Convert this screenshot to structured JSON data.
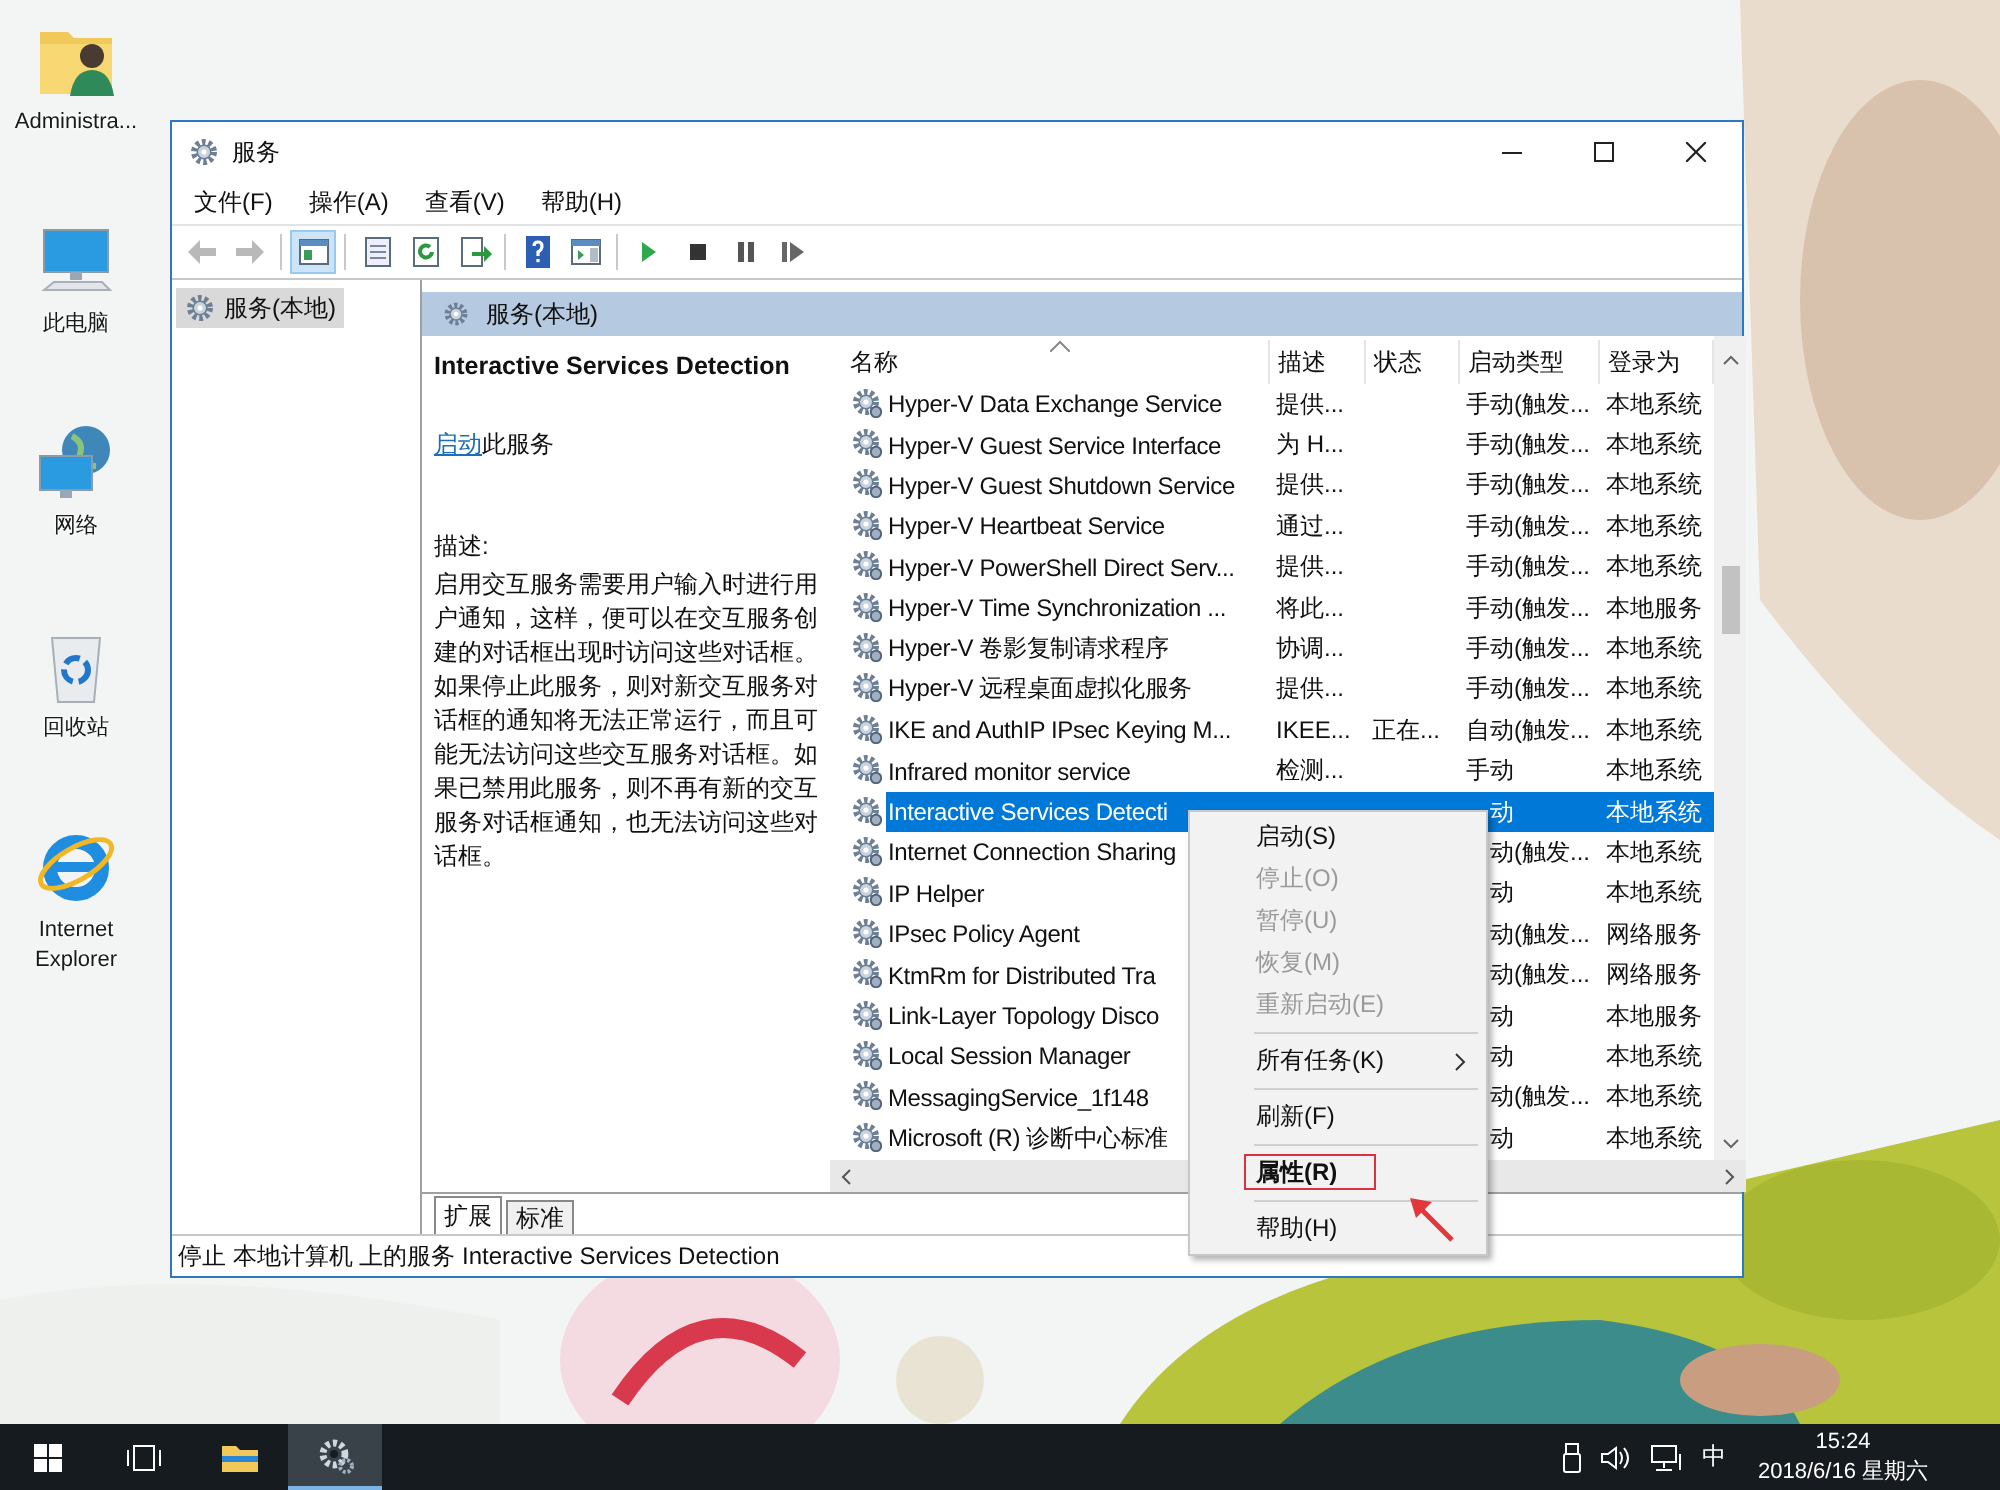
{
  "desktop_icons": [
    {
      "label": "Administra...",
      "kind": "user-folder"
    },
    {
      "label": "此电脑",
      "kind": "computer"
    },
    {
      "label": "网络",
      "kind": "network"
    },
    {
      "label": "回收站",
      "kind": "recycle-bin"
    },
    {
      "label": "Internet Explorer",
      "kind": "browser"
    }
  ],
  "window": {
    "title": "服务"
  },
  "menu": [
    "文件(F)",
    "操作(A)",
    "查看(V)",
    "帮助(H)"
  ],
  "toolbar": [
    {
      "kind": "back",
      "disabled": true,
      "pressed": false
    },
    {
      "kind": "forward",
      "disabled": true,
      "pressed": false
    },
    {
      "kind": "separator"
    },
    {
      "kind": "tree",
      "disabled": false,
      "pressed": true
    },
    {
      "kind": "separator"
    },
    {
      "kind": "properties",
      "disabled": false,
      "pressed": false
    },
    {
      "kind": "refresh",
      "disabled": false,
      "pressed": false
    },
    {
      "kind": "export",
      "disabled": false,
      "pressed": false
    },
    {
      "kind": "separator"
    },
    {
      "kind": "help",
      "disabled": false,
      "pressed": false
    },
    {
      "kind": "action-pane",
      "disabled": false,
      "pressed": false
    },
    {
      "kind": "separator"
    },
    {
      "kind": "play",
      "disabled": false,
      "pressed": false
    },
    {
      "kind": "stop",
      "disabled": false,
      "pressed": false
    },
    {
      "kind": "pause",
      "disabled": false,
      "pressed": false
    },
    {
      "kind": "resume",
      "disabled": false,
      "pressed": false
    }
  ],
  "tree": {
    "items": [
      {
        "label": "服务(本地)",
        "selected": true
      }
    ]
  },
  "pane_header": "服务(本地)",
  "details": {
    "title": "Interactive Services Detection",
    "action_link": "启动",
    "action_text": "此服务",
    "description_label": "描述:",
    "description": "启用交互服务需要用户输入时进行用户通知，这样，便可以在交互服务创建的对话框出现时访问这些对话框。如果停止此服务，则对新交互服务对话框的通知将无法正常运行，而且可能无法访问这些交互服务对话框。如果已禁用此服务，则不再有新的交互服务对话框通知，也无法访问这些对话框。"
  },
  "columns": [
    {
      "label": "名称",
      "sorted": true
    },
    {
      "label": "描述",
      "sorted": false
    },
    {
      "label": "状态",
      "sorted": false
    },
    {
      "label": "启动类型",
      "sorted": false
    },
    {
      "label": "登录为",
      "sorted": false
    }
  ],
  "rows": [
    {
      "name": "Hyper-V Data Exchange Service",
      "description": "提供...",
      "startup": "手动(触发...",
      "logon": "本地系统",
      "selected": false
    },
    {
      "name": "Hyper-V Guest Service Interface",
      "description": "为 H...",
      "startup": "手动(触发...",
      "logon": "本地系统",
      "selected": false
    },
    {
      "name": "Hyper-V Guest Shutdown Service",
      "description": "提供...",
      "startup": "手动(触发...",
      "logon": "本地系统",
      "selected": false
    },
    {
      "name": "Hyper-V Heartbeat Service",
      "description": "通过...",
      "startup": "手动(触发...",
      "logon": "本地系统",
      "selected": false
    },
    {
      "name": "Hyper-V PowerShell Direct Serv...",
      "description": "提供...",
      "startup": "手动(触发...",
      "logon": "本地系统",
      "selected": false
    },
    {
      "name": "Hyper-V Time Synchronization ...",
      "description": "将此...",
      "startup": "手动(触发...",
      "logon": "本地服务",
      "selected": false
    },
    {
      "name": "Hyper-V 卷影复制请求程序",
      "description": "协调...",
      "startup": "手动(触发...",
      "logon": "本地系统",
      "selected": false
    },
    {
      "name": "Hyper-V 远程桌面虚拟化服务",
      "description": "提供...",
      "startup": "手动(触发...",
      "logon": "本地系统",
      "selected": false
    },
    {
      "name": "IKE and AuthIP IPsec Keying M...",
      "description": "IKEE...",
      "status": "正在...",
      "startup": "自动(触发...",
      "logon": "本地系统",
      "selected": false
    },
    {
      "name": "Infrared monitor service",
      "description": "检测...",
      "startup": "手动",
      "logon": "本地系统",
      "selected": false
    },
    {
      "name": "Interactive Services Detecti",
      "startup": "动",
      "logon": "本地系统",
      "selected": true
    },
    {
      "name": "Internet Connection Sharing",
      "startup": "动(触发...",
      "logon": "本地系统",
      "selected": false
    },
    {
      "name": "IP Helper",
      "startup": "动",
      "logon": "本地系统",
      "selected": false
    },
    {
      "name": "IPsec Policy Agent",
      "startup": "动(触发...",
      "logon": "网络服务",
      "selected": false
    },
    {
      "name": "KtmRm for Distributed Tra",
      "startup": "动(触发...",
      "logon": "网络服务",
      "selected": false
    },
    {
      "name": "Link-Layer Topology Disco",
      "startup": "动",
      "logon": "本地服务",
      "selected": false
    },
    {
      "name": "Local Session Manager",
      "startup": "动",
      "logon": "本地系统",
      "selected": false
    },
    {
      "name": "MessagingService_1f148",
      "startup": "动(触发...",
      "logon": "本地系统",
      "selected": false
    },
    {
      "name": "Microsoft (R) 诊断中心标准",
      "startup": "动",
      "logon": "本地系统",
      "selected": false
    }
  ],
  "tabs": [
    {
      "label": "扩展",
      "selected": true
    },
    {
      "label": "标准",
      "selected": false
    }
  ],
  "status_bar": "停止 本地计算机 上的服务 Interactive Services Detection",
  "context_menu": [
    {
      "kind": "item",
      "label": "启动(S)",
      "disabled": false,
      "default": false,
      "submenu": false,
      "annotated": false
    },
    {
      "kind": "item",
      "label": "停止(O)",
      "disabled": true,
      "default": false,
      "submenu": false,
      "annotated": false
    },
    {
      "kind": "item",
      "label": "暂停(U)",
      "disabled": true,
      "default": false,
      "submenu": false,
      "annotated": false
    },
    {
      "kind": "item",
      "label": "恢复(M)",
      "disabled": true,
      "default": false,
      "submenu": false,
      "annotated": false
    },
    {
      "kind": "item",
      "label": "重新启动(E)",
      "disabled": true,
      "default": false,
      "submenu": false,
      "annotated": false
    },
    {
      "kind": "separator"
    },
    {
      "kind": "item",
      "label": "所有任务(K)",
      "disabled": false,
      "default": false,
      "submenu": true,
      "annotated": false
    },
    {
      "kind": "separator"
    },
    {
      "kind": "item",
      "label": "刷新(F)",
      "disabled": false,
      "default": false,
      "submenu": false,
      "annotated": false
    },
    {
      "kind": "separator"
    },
    {
      "kind": "item",
      "label": "属性(R)",
      "disabled": false,
      "default": true,
      "submenu": false,
      "annotated": true
    },
    {
      "kind": "separator"
    },
    {
      "kind": "item",
      "label": "帮助(H)",
      "disabled": false,
      "default": false,
      "submenu": false,
      "annotated": false
    }
  ],
  "taskbar": {
    "apps": [
      {
        "kind": "start",
        "active": false
      },
      {
        "kind": "task-view",
        "active": false
      },
      {
        "kind": "explorer",
        "active": false
      },
      {
        "kind": "services",
        "active": true
      }
    ],
    "input_method": "中",
    "time": "15:24",
    "date": "2018/6/16 星期六"
  }
}
